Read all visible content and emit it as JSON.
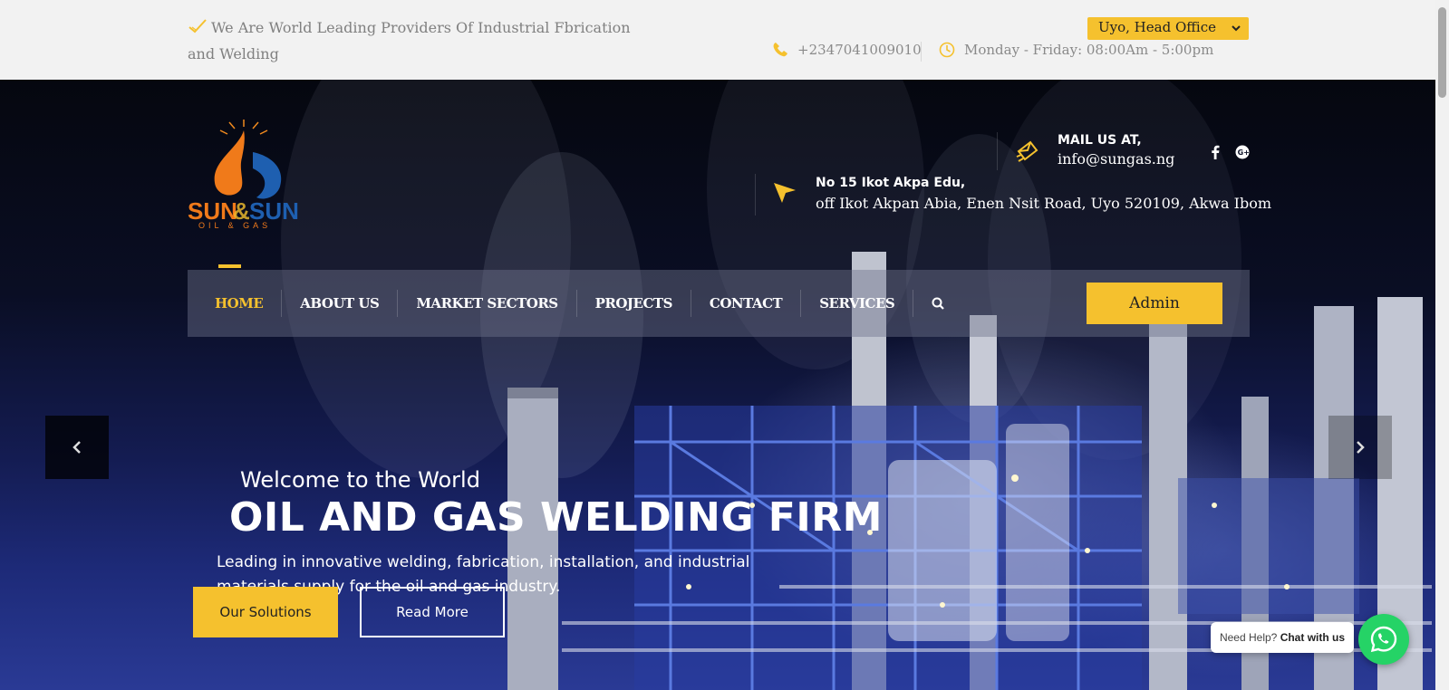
{
  "topbar": {
    "tagline": "We Are World Leading Providers Of Industrial Fbrication and Welding",
    "location_select": "Uyo, Head Office",
    "phone": "+2347041009010",
    "hours": "Monday - Friday: 08:00Am - 5:00pm"
  },
  "header": {
    "logo_text": "SUN&SUN OIL & GAS",
    "mail_title": "MAIL US AT,",
    "mail_value": "info@sungas.ng",
    "address_line1": "No 15 Ikot Akpa Edu,",
    "address_line2": "off Ikot Akpan Abia, Enen Nsit Road, Uyo 520109, Akwa Ibom"
  },
  "nav": {
    "items": [
      {
        "label": "HOME",
        "active": true
      },
      {
        "label": "ABOUT US",
        "active": false
      },
      {
        "label": "MARKET SECTORS",
        "active": false
      },
      {
        "label": "PROJECTS",
        "active": false
      },
      {
        "label": "CONTACT",
        "active": false
      },
      {
        "label": "SERVICES",
        "active": false
      }
    ],
    "admin_label": "Admin"
  },
  "hero": {
    "welcome": "Welcome to the World",
    "headline": "OIL AND GAS WELDING FIRM",
    "subtext": "Leading in innovative welding, fabrication, installation, and industrial materials supply for the oil and gas industry.",
    "primary_button": "Our Solutions",
    "secondary_button": "Read More"
  },
  "chat": {
    "help_text": "Need Help?",
    "chat_text": "Chat with us"
  },
  "colors": {
    "accent": "#f5c12e",
    "whatsapp": "#25d366",
    "topbar_bg": "#f2f2f2"
  },
  "icons": [
    "check-icon",
    "chevron-down-icon",
    "phone-icon",
    "clock-icon",
    "mail-icon",
    "facebook-icon",
    "google-plus-icon",
    "location-arrow-icon",
    "search-icon",
    "chevron-left-icon",
    "chevron-right-icon",
    "whatsapp-icon"
  ]
}
